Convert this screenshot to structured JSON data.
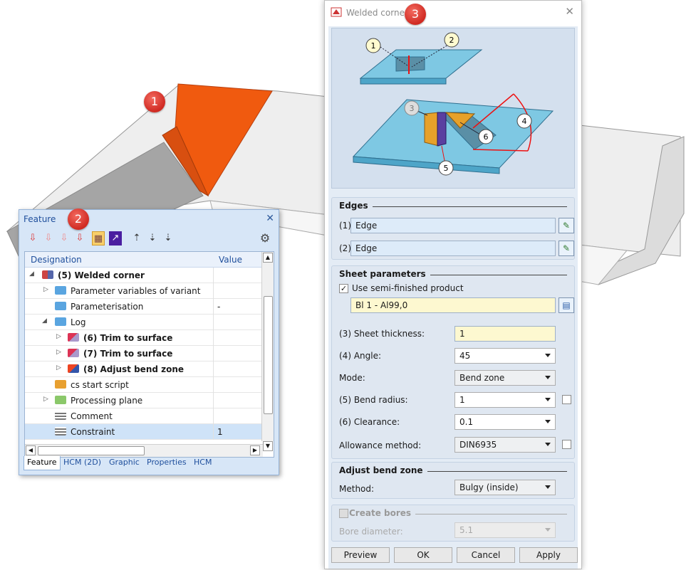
{
  "badges": {
    "one": "1",
    "two": "2",
    "three": "3"
  },
  "feature_panel": {
    "title": "Feature",
    "close_icon": "close-icon",
    "columns": {
      "designation": "Designation",
      "value": "Value"
    },
    "rows": [
      {
        "label": "(5) Welded corner",
        "value": "",
        "bold": true
      },
      {
        "label": "Parameter variables of variant",
        "value": ""
      },
      {
        "label": "Parameterisation",
        "value": "-"
      },
      {
        "label": "Log",
        "value": ""
      },
      {
        "label": "(6) Trim to surface",
        "value": "",
        "bold": true
      },
      {
        "label": "(7) Trim to surface",
        "value": "",
        "bold": true
      },
      {
        "label": "(8) Adjust bend zone",
        "value": "",
        "bold": true
      },
      {
        "label": "cs start script",
        "value": ""
      },
      {
        "label": "Processing plane",
        "value": ""
      },
      {
        "label": "Comment",
        "value": ""
      },
      {
        "label": "Constraint",
        "value": "1"
      }
    ],
    "tabs": [
      "Feature",
      "HCM (2D)",
      "Graphic",
      "Properties",
      "HCM"
    ]
  },
  "dialog": {
    "title": "Welded corner",
    "illustration_callouts": [
      "1",
      "2",
      "3",
      "4",
      "5",
      "6"
    ],
    "edges": {
      "title": "Edges",
      "edge1_label": "(1)",
      "edge1_value": "Edge",
      "edge2_label": "(2)",
      "edge2_value": "Edge"
    },
    "sheet": {
      "title": "Sheet parameters",
      "semi_finished_label": "Use semi-finished product",
      "semi_finished_checked": true,
      "product": "Bl 1 - Al99,0",
      "thickness_label": "(3) Sheet thickness:",
      "thickness": "1",
      "angle_label": "(4) Angle:",
      "angle": "45",
      "mode_label": "Mode:",
      "mode": "Bend zone",
      "bend_radius_label": "(5) Bend radius:",
      "bend_radius": "1",
      "clearance_label": "(6) Clearance:",
      "clearance": "0.1",
      "allowance_label": "Allowance method:",
      "allowance": "DIN6935"
    },
    "adjust": {
      "title": "Adjust bend zone",
      "method_label": "Method:",
      "method": "Bulgy (inside)"
    },
    "bores": {
      "title": "Create bores",
      "diameter_label": "Bore diameter:",
      "diameter": "5.1"
    },
    "buttons": {
      "preview": "Preview",
      "ok": "OK",
      "cancel": "Cancel",
      "apply": "Apply"
    }
  }
}
